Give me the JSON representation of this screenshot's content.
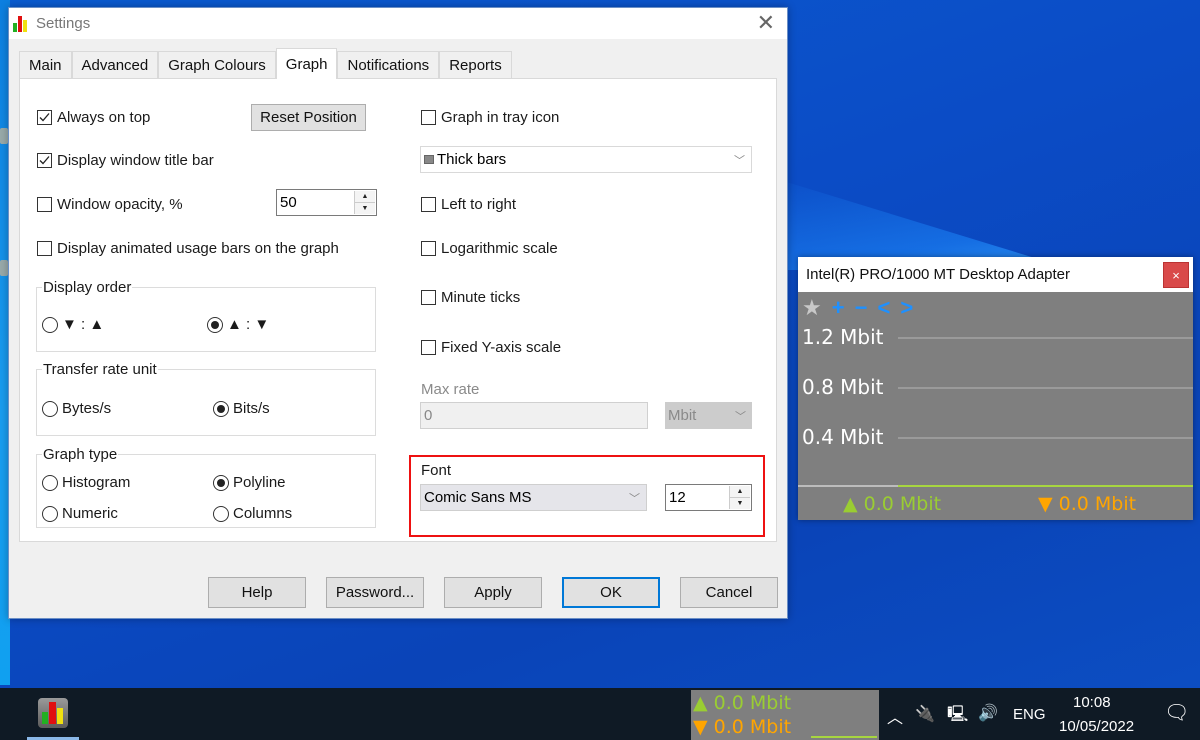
{
  "settings": {
    "title": "Settings",
    "tabs": [
      {
        "label": "Main"
      },
      {
        "label": "Advanced"
      },
      {
        "label": "Graph Colours"
      },
      {
        "label": "Graph",
        "active": true
      },
      {
        "label": "Notifications"
      },
      {
        "label": "Reports"
      }
    ],
    "left": {
      "always_on_top": {
        "label": "Always on top",
        "checked": true
      },
      "reset_position": "Reset Position",
      "display_title_bar": {
        "label": "Display window title bar",
        "checked": true
      },
      "window_opacity": {
        "label": "Window opacity, %",
        "checked": false,
        "value": "50"
      },
      "animated_bars": {
        "label": "Display animated usage bars on the graph",
        "checked": false
      },
      "display_order": {
        "title": "Display order",
        "options": [
          {
            "label": "▼ : ▲",
            "selected": false
          },
          {
            "label": "▲ : ▼",
            "selected": true
          }
        ]
      },
      "transfer_unit": {
        "title": "Transfer rate unit",
        "options": [
          {
            "label": "Bytes/s",
            "selected": false
          },
          {
            "label": "Bits/s",
            "selected": true
          }
        ]
      },
      "graph_type": {
        "title": "Graph type",
        "options": [
          {
            "label": "Histogram",
            "selected": false
          },
          {
            "label": "Polyline",
            "selected": true
          },
          {
            "label": "Numeric",
            "selected": false
          },
          {
            "label": "Columns",
            "selected": false
          }
        ]
      }
    },
    "right": {
      "graph_in_tray": {
        "label": "Graph in tray icon",
        "checked": false
      },
      "tray_style": {
        "value": "Thick bars"
      },
      "left_to_right": {
        "label": "Left to right",
        "checked": false
      },
      "log_scale": {
        "label": "Logarithmic scale",
        "checked": false
      },
      "minute_ticks": {
        "label": "Minute ticks",
        "checked": false
      },
      "fixed_y": {
        "label": "Fixed Y-axis scale",
        "checked": false
      },
      "max_rate": {
        "label": "Max rate",
        "value": "0",
        "unit": "Mbit"
      },
      "font": {
        "label": "Font",
        "family": "Comic Sans MS",
        "size": "12"
      }
    },
    "buttons": {
      "help": "Help",
      "password": "Password...",
      "apply": "Apply",
      "ok": "OK",
      "cancel": "Cancel"
    }
  },
  "widget": {
    "title": "Intel(R) PRO/1000 MT Desktop Adapter",
    "close": "×",
    "tools": [
      "★",
      "+",
      "−",
      "<",
      ">"
    ],
    "scale_labels": [
      "1.2 Mbit",
      "0.8 Mbit",
      "0.4 Mbit"
    ],
    "upload": "▲ 0.0 Mbit",
    "download": "▼ 0.0 Mbit",
    "colors": {
      "upload": "#9acd32",
      "download": "#ffa500",
      "tools": "#1e90ff"
    }
  },
  "taskbar": {
    "meter_up": "▲ 0.0 Mbit",
    "meter_down": "▼ 0.0 Mbit",
    "language": "ENG",
    "time": "10:08",
    "date": "10/05/2022"
  }
}
